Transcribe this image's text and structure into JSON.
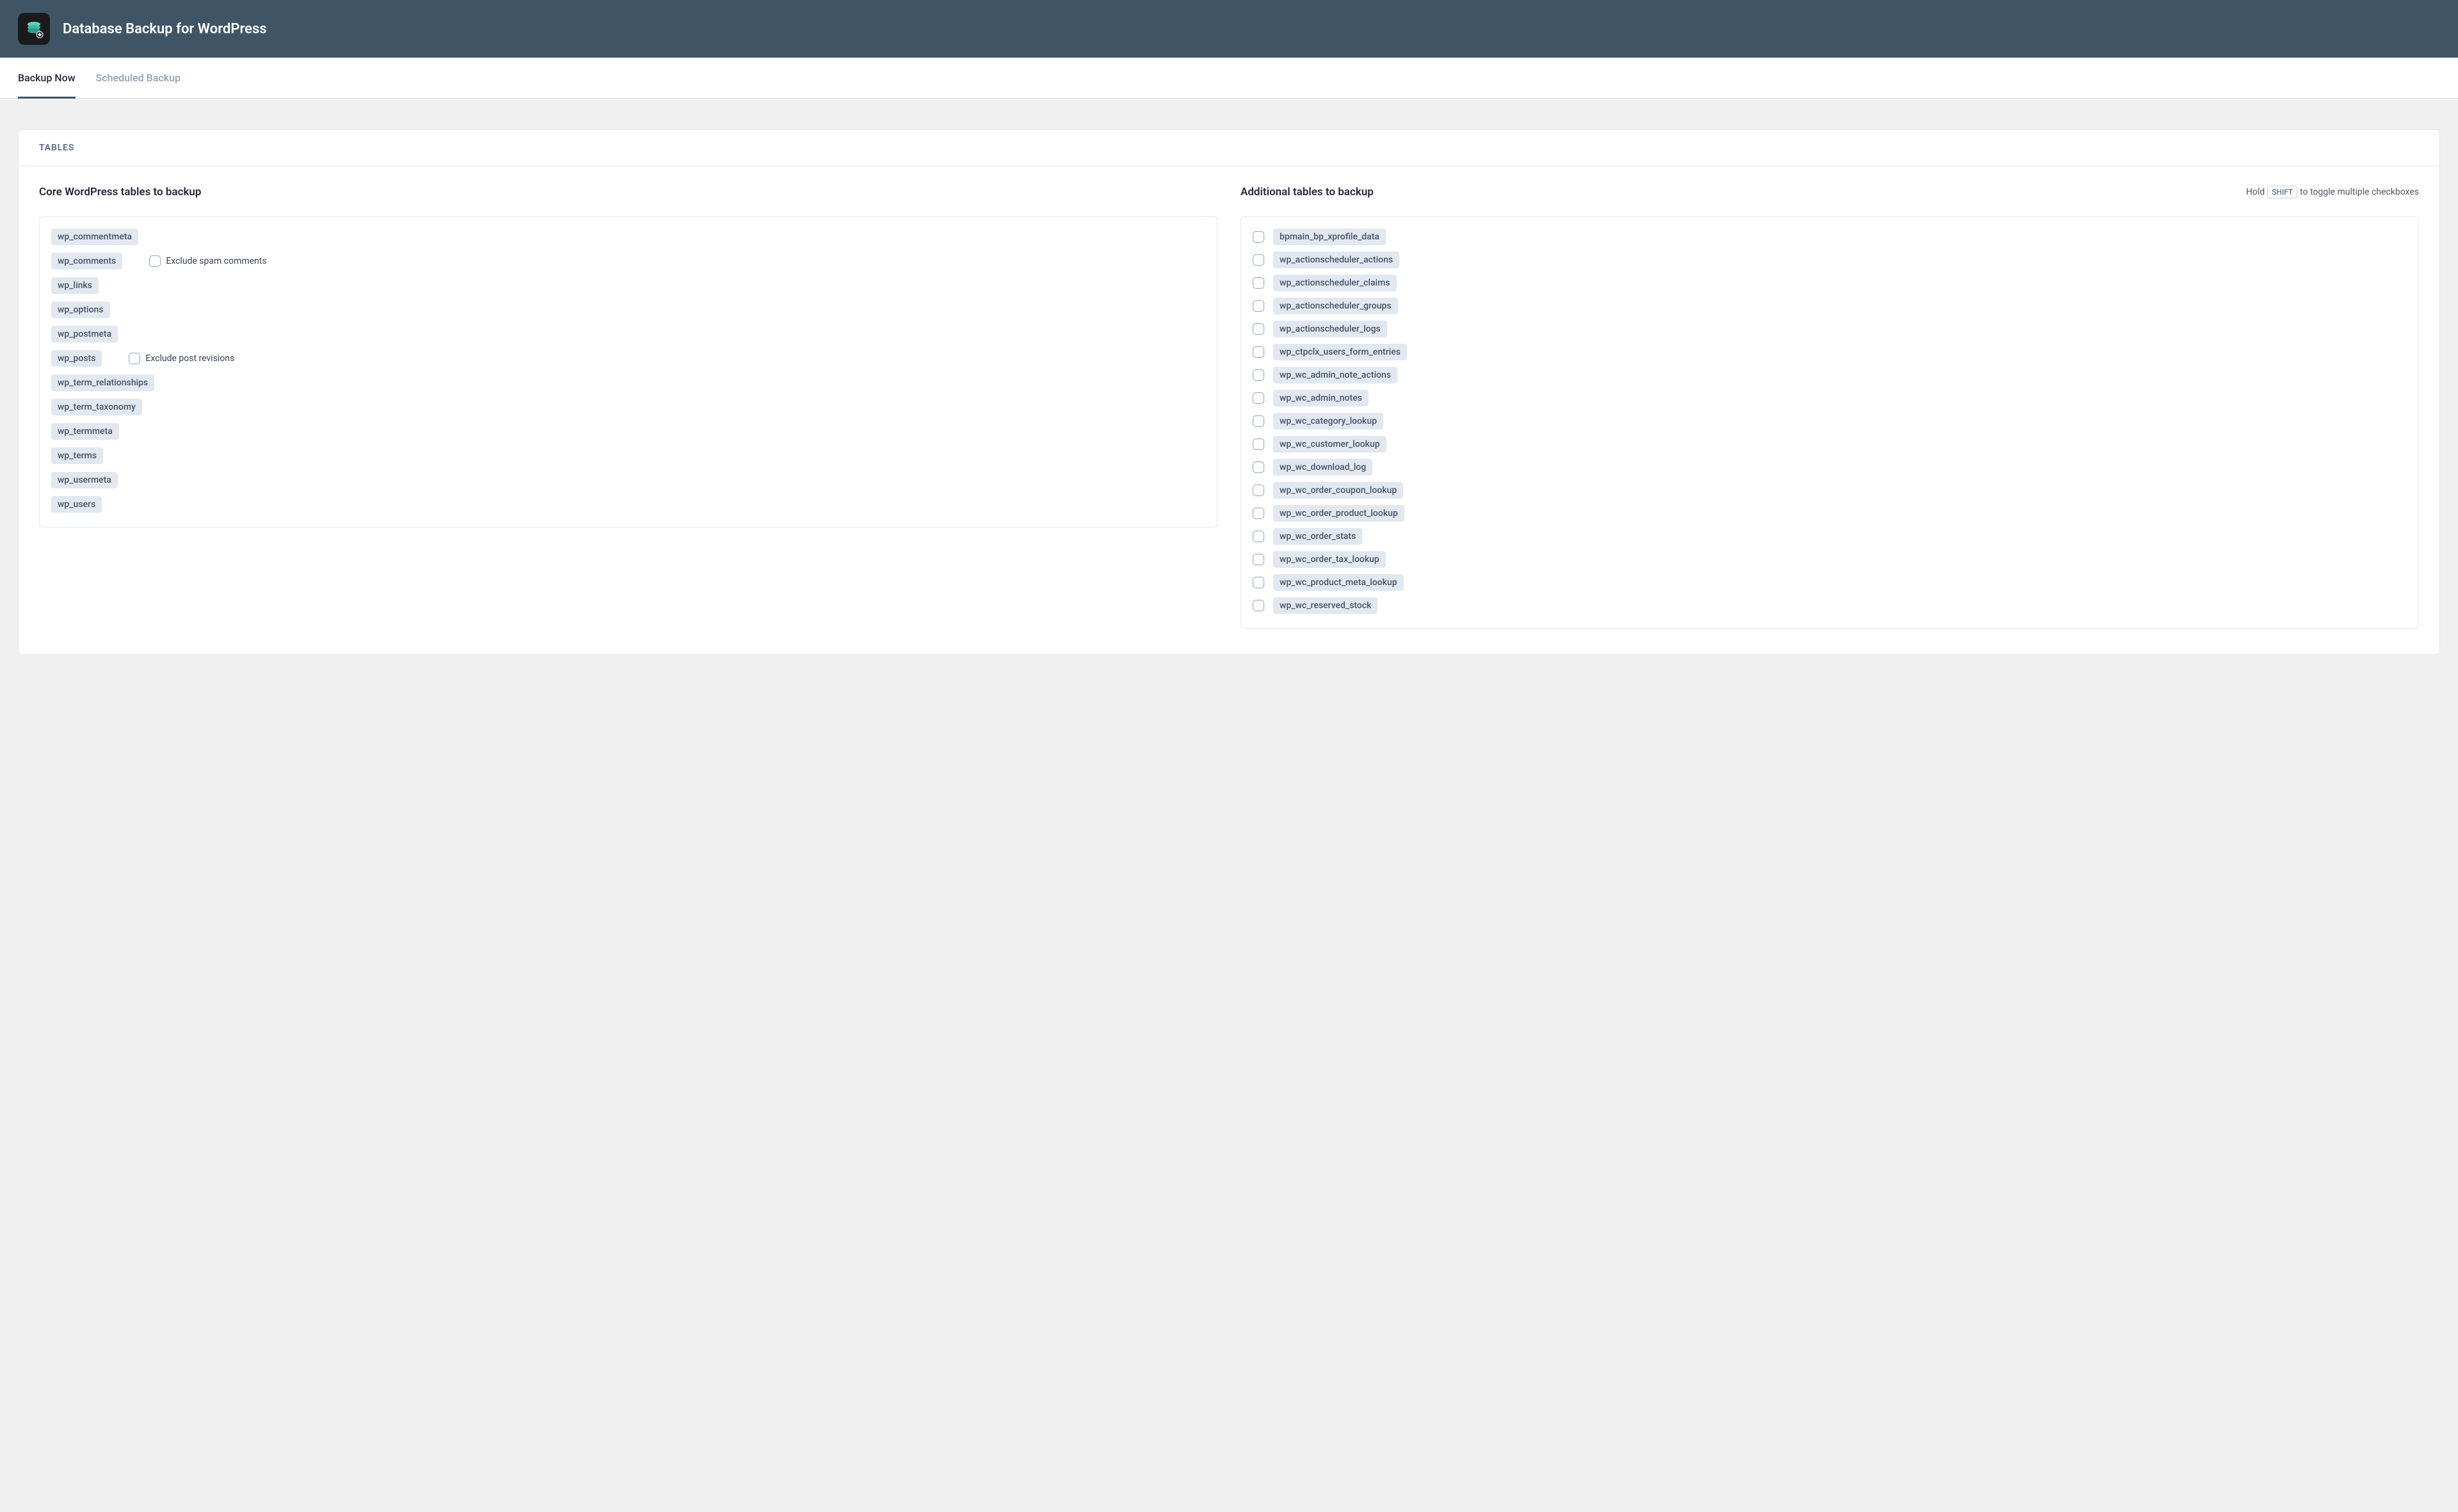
{
  "header": {
    "title": "Database Backup for WordPress"
  },
  "tabs": [
    {
      "label": "Backup Now",
      "active": true
    },
    {
      "label": "Scheduled Backup",
      "active": false
    }
  ],
  "panel": {
    "title": "TABLES"
  },
  "core": {
    "title": "Core WordPress tables to backup",
    "exclude_spam_label": "Exclude spam comments",
    "exclude_revisions_label": "Exclude post revisions",
    "tables": [
      {
        "name": "wp_commentmeta"
      },
      {
        "name": "wp_comments",
        "option": "exclude_spam"
      },
      {
        "name": "wp_links"
      },
      {
        "name": "wp_options"
      },
      {
        "name": "wp_postmeta"
      },
      {
        "name": "wp_posts",
        "option": "exclude_revisions"
      },
      {
        "name": "wp_term_relationships"
      },
      {
        "name": "wp_term_taxonomy"
      },
      {
        "name": "wp_termmeta"
      },
      {
        "name": "wp_terms"
      },
      {
        "name": "wp_usermeta"
      },
      {
        "name": "wp_users"
      }
    ]
  },
  "additional": {
    "title": "Additional tables to backup",
    "hint_prefix": "Hold",
    "hint_key": "SHIFT",
    "hint_suffix": "to toggle multiple checkboxes",
    "tables": [
      "bpmain_bp_xprofile_data",
      "wp_actionscheduler_actions",
      "wp_actionscheduler_claims",
      "wp_actionscheduler_groups",
      "wp_actionscheduler_logs",
      "wp_ctpclx_users_form_entries",
      "wp_wc_admin_note_actions",
      "wp_wc_admin_notes",
      "wp_wc_category_lookup",
      "wp_wc_customer_lookup",
      "wp_wc_download_log",
      "wp_wc_order_coupon_lookup",
      "wp_wc_order_product_lookup",
      "wp_wc_order_stats",
      "wp_wc_order_tax_lookup",
      "wp_wc_product_meta_lookup",
      "wp_wc_reserved_stock"
    ]
  }
}
